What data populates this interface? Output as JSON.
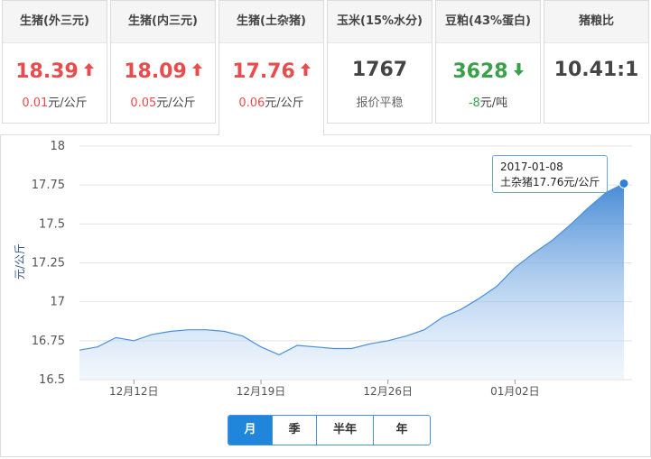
{
  "cards": [
    {
      "title": "生猪(外三元)",
      "value": "18.39",
      "trend": "up",
      "change": "0.01",
      "unit": "元/公斤"
    },
    {
      "title": "生猪(内三元)",
      "value": "18.09",
      "trend": "up",
      "change": "0.05",
      "unit": "元/公斤"
    },
    {
      "title": "生猪(土杂猪)",
      "value": "17.76",
      "trend": "up",
      "change": "0.06",
      "unit": "元/公斤"
    },
    {
      "title": "玉米(15%水分)",
      "value": "1767",
      "trend": "flat",
      "note": "报价平稳"
    },
    {
      "title": "豆粕(43%蛋白)",
      "value": "3628",
      "trend": "down",
      "change": "-8",
      "unit": "元/吨"
    },
    {
      "title": "猪粮比",
      "value": "10.41:1",
      "trend": "flat"
    }
  ],
  "colors": {
    "up": "#e84c4c",
    "down": "#3aa04a",
    "line": "#4a90d9",
    "accent": "#1f86db"
  },
  "tooltip": {
    "date": "2017-01-08",
    "label": "土杂猪17.76元/公斤"
  },
  "range_tabs": [
    "月",
    "季",
    "半年",
    "年"
  ],
  "range_selected": "月",
  "chart_data": {
    "type": "area",
    "ylabel": "元/公斤",
    "ylim": [
      16.5,
      18
    ],
    "yticks": [
      "16.5",
      "16.75",
      "17",
      "17.25",
      "17.5",
      "17.75",
      "18"
    ],
    "xticks": [
      {
        "label": "12月12日",
        "x": "2016-12-12"
      },
      {
        "label": "12月19日",
        "x": "2016-12-19"
      },
      {
        "label": "12月26日",
        "x": "2016-12-26"
      },
      {
        "label": "01月02日",
        "x": "2017-01-02"
      }
    ],
    "x": [
      "2016-12-09",
      "2016-12-10",
      "2016-12-11",
      "2016-12-12",
      "2016-12-13",
      "2016-12-14",
      "2016-12-15",
      "2016-12-16",
      "2016-12-17",
      "2016-12-18",
      "2016-12-19",
      "2016-12-20",
      "2016-12-21",
      "2016-12-22",
      "2016-12-23",
      "2016-12-24",
      "2016-12-25",
      "2016-12-26",
      "2016-12-27",
      "2016-12-28",
      "2016-12-29",
      "2016-12-30",
      "2016-12-31",
      "2017-01-01",
      "2017-01-02",
      "2017-01-03",
      "2017-01-04",
      "2017-01-05",
      "2017-01-06",
      "2017-01-07",
      "2017-01-08"
    ],
    "series": [
      {
        "values": [
          16.69,
          16.71,
          16.77,
          16.75,
          16.79,
          16.81,
          16.82,
          16.82,
          16.81,
          16.78,
          16.71,
          16.66,
          16.72,
          16.71,
          16.7,
          16.7,
          16.73,
          16.75,
          16.78,
          16.82,
          16.9,
          16.95,
          17.02,
          17.1,
          17.22,
          17.31,
          17.39,
          17.49,
          17.6,
          17.7,
          17.76
        ]
      }
    ],
    "grid": "horizontal",
    "highlight": {
      "x": "2017-01-08",
      "y": 17.76
    }
  }
}
